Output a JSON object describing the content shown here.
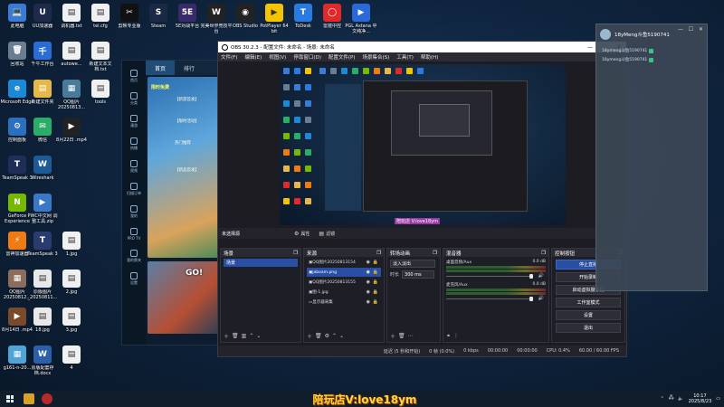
{
  "desktop": {
    "icons_col1": [
      {
        "label": "此电脑",
        "color": "#3a7bd5",
        "glyph": "💻"
      },
      {
        "label": "回收站",
        "color": "#6b7d90",
        "glyph": "🗑"
      },
      {
        "label": "Microsoft Edge",
        "color": "#1b8ad6",
        "glyph": "e"
      },
      {
        "label": "控制面板",
        "color": "#2b6fbf",
        "glyph": "⚙"
      },
      {
        "label": "TeamSpeak 3",
        "color": "#1f2d57",
        "glyph": "T"
      },
      {
        "label": "GeForce Experience",
        "color": "#76b900",
        "glyph": "N"
      },
      {
        "label": "雷神加速器",
        "color": "#f07b12",
        "glyph": "⚡"
      },
      {
        "label": "QQ图片 20250812...",
        "color": "#8a6d5a",
        "glyph": "▦"
      },
      {
        "label": "8月14日 .mp4",
        "color": "#7a4a2a",
        "glyph": "▶"
      },
      {
        "label": "g161-n-20...",
        "color": "#4fa3d6",
        "glyph": "▦"
      }
    ],
    "icons_col2": [
      {
        "label": "UU加速器",
        "color": "#1d2a4a",
        "glyph": "U"
      },
      {
        "label": "千牛工作台",
        "color": "#2a6cd6",
        "glyph": "千"
      },
      {
        "label": "新建文件夹",
        "color": "#e6b84a",
        "glyph": "▤"
      },
      {
        "label": "微信",
        "color": "#2aae67",
        "glyph": "✉"
      },
      {
        "label": "Wireshark",
        "color": "#1e5a96",
        "glyph": "W"
      },
      {
        "label": "PWC中文网 调整工具.zip",
        "color": "#3a78c6",
        "glyph": "▶"
      },
      {
        "label": "TeamSpeak 3",
        "color": "#2a3c6e",
        "glyph": "T"
      },
      {
        "label": "原版图片 _20250811...",
        "color": "#e8e8e8",
        "glyph": "▤"
      },
      {
        "label": "18.jpg",
        "color": "#e8e8e8",
        "glyph": "▤"
      },
      {
        "label": "原版配套存档.docx",
        "color": "#2b5faa",
        "glyph": "W"
      }
    ],
    "icons_col3": [
      {
        "label": "调机器.txt",
        "color": "#f0f0f0",
        "glyph": "▤"
      },
      {
        "label": "autowe...",
        "color": "#f0f0f0",
        "glyph": "▤"
      },
      {
        "label": "QQ图片 20250813...",
        "color": "#4a7a9a",
        "glyph": "▦"
      },
      {
        "label": "8月22日 .mp4",
        "color": "#222",
        "glyph": "▶"
      },
      {
        "label": "1.jpg",
        "color": "#f0f0f0",
        "glyph": "▤"
      },
      {
        "label": "2.jpg",
        "color": "#f0f0f0",
        "glyph": "▤"
      },
      {
        "label": "3.jpg",
        "color": "#f0f0f0",
        "glyph": "▤"
      },
      {
        "label": "4",
        "color": "#f0f0f0",
        "glyph": "▤"
      }
    ],
    "icons_top": [
      {
        "label": "tei.cfg",
        "color": "#f0f0f0",
        "glyph": "▤"
      },
      {
        "label": "剪映专业版",
        "color": "#111",
        "glyph": "✂"
      },
      {
        "label": "Steam",
        "color": "#1b2a44",
        "glyph": "S"
      },
      {
        "label": "5E对战平台",
        "color": "#3a2a6a",
        "glyph": "5E"
      },
      {
        "label": "完美世界竞技平台",
        "color": "#222",
        "glyph": "W"
      },
      {
        "label": "OBS Studio",
        "color": "#222",
        "glyph": "◉"
      },
      {
        "label": "PotPlayer 64 bit",
        "color": "#f5c400",
        "glyph": "▶"
      },
      {
        "label": "ToDesk",
        "color": "#2a7ae2",
        "glyph": "T"
      },
      {
        "label": "雷霆中控",
        "color": "#e02a2a",
        "glyph": "◯"
      },
      {
        "label": "PGL Astana 中文纯净...",
        "color": "#2a6ad6",
        "glyph": "▶"
      }
    ],
    "icon_tools": {
      "label": "tools",
      "color": "#f0f0f0",
      "glyph": "▤"
    },
    "icon_newdoc": {
      "label": "新建文本文 档.txt",
      "color": "#f0f0f0",
      "glyph": "▤"
    }
  },
  "app_window": {
    "tabs": [
      "首页",
      "排行"
    ],
    "sidebar": [
      "首页",
      "分类",
      "漫游",
      "热播",
      "视频",
      "扫描订单",
      "我的",
      "PRO TV",
      "我的票夹",
      "设置"
    ],
    "banner_lines": [
      "【新游首发】",
      "【限时活动】",
      "热门推荐",
      "限时免费",
      "【新品首发】"
    ],
    "thumb_text": "GO!"
  },
  "obs": {
    "title": "OBS 30.2.3 - 配置文件: 未命名 - 场景: 未命名",
    "menu": [
      "文件(F)",
      "编辑(E)",
      "视图(V)",
      "停靠窗口(D)",
      "配置文件(P)",
      "场景集合(S)",
      "工具(T)",
      "帮助(H)"
    ],
    "source_bar": {
      "no_source": "未选择源",
      "properties": "属性",
      "filters": "滤镜"
    },
    "docks": {
      "scenes": {
        "title": "场景",
        "items": [
          "场景"
        ]
      },
      "sources": {
        "title": "来源",
        "items": [
          "QQ图片20250813154",
          "jaboam.png",
          "QQ图片20250813155",
          "图-1.jpg",
          "显示器采集"
        ]
      },
      "transitions": {
        "title": "转场动画",
        "type": "淡入淡出",
        "duration_label": "时长",
        "duration_value": "300 ms"
      },
      "mixer": {
        "title": "混音器",
        "channels": [
          {
            "name": "桌面音频/Aux",
            "db": "0.0 dB"
          },
          {
            "name": "麦克风/Aux",
            "db": "0.0 dB"
          }
        ]
      },
      "controls": {
        "title": "控制按钮",
        "buttons": [
          "停止直播",
          "开始录制",
          "启动虚拟摄像机",
          "工作室模式",
          "设置",
          "退出"
        ]
      }
    },
    "preview_banner": "陪玩店 V:love18ym",
    "status": {
      "lag": "延迟 (5 秒和开始)",
      "frames": "0 帧 (0.0%)",
      "bitrate": "0 kbps",
      "time1": "00:00:00",
      "time2": "00:00:00",
      "cpu": "CPU: 0.4%",
      "fps": "60.00 / 60.00 FPS"
    }
  },
  "chat": {
    "user": "18yMeng斗鱼5190741",
    "lines": [
      {
        "text": "18ymeng斗鱼5190741"
      },
      {
        "text": "18ymeng斗鱼5190741"
      }
    ]
  },
  "watermark": "陪玩店V:love18ym",
  "taskbar": {
    "time": "10:17",
    "date": "2025/8/23"
  }
}
